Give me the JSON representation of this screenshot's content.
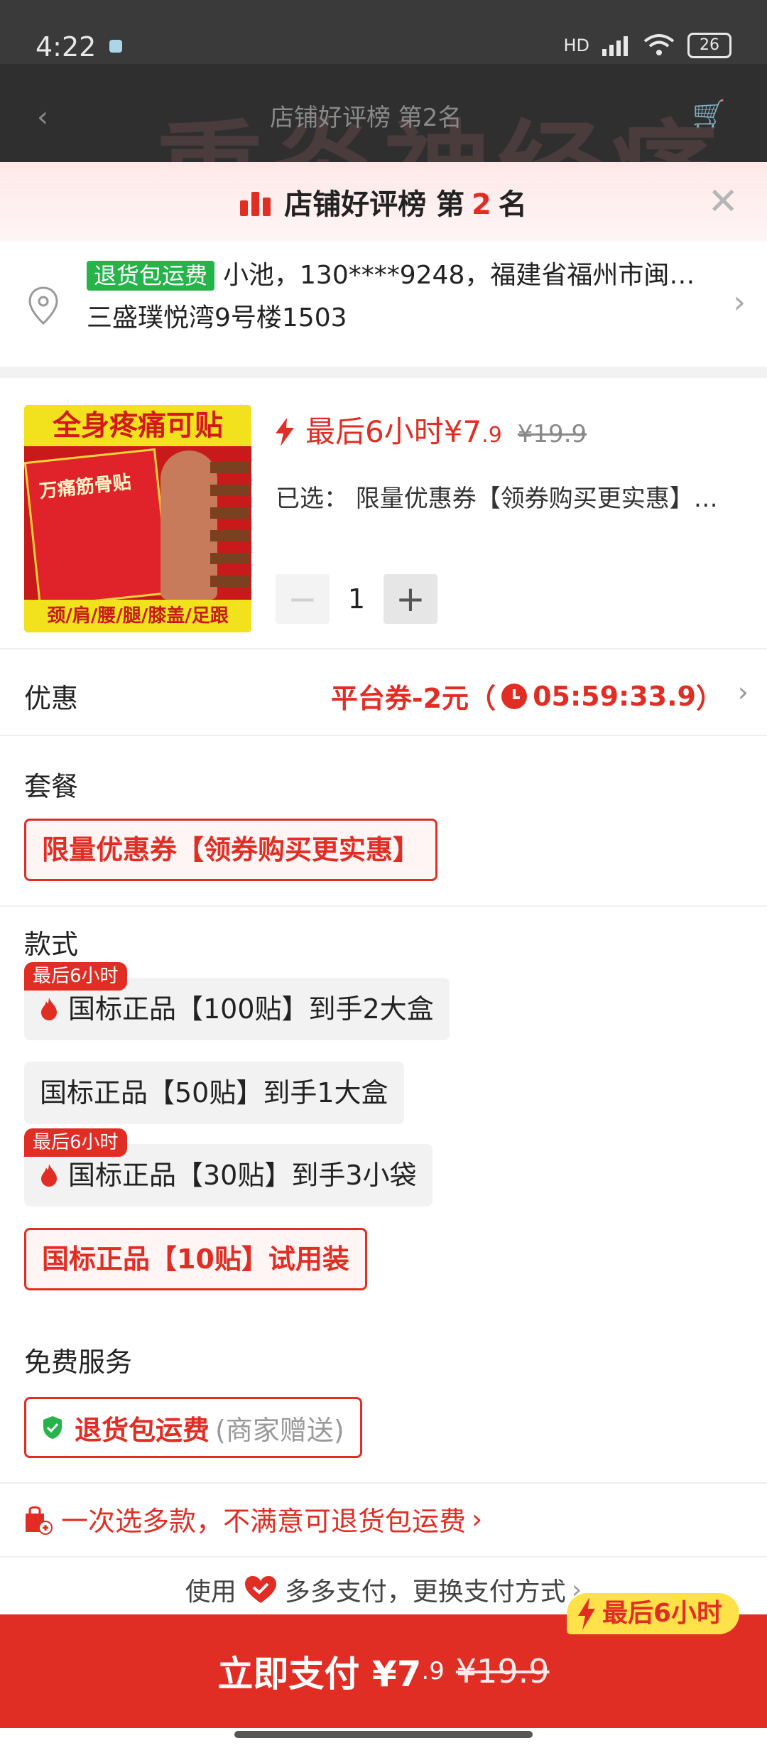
{
  "status_bar": {
    "time": "4:22",
    "battery": "26",
    "network": "HD"
  },
  "backdrop": {
    "title": "店铺好评榜 第2名",
    "ghost_text": "重炎神经痛"
  },
  "sheet": {
    "header": {
      "title_prefix": "店铺好评榜 第",
      "rank": "2",
      "title_suffix": "名"
    },
    "address": {
      "tag": "退货包运费",
      "line1": "小池，130****9248，福建省福州市闽…",
      "line2": "三盛璞悦湾9号楼1503"
    },
    "product": {
      "image_top": "全身疼痛可贴",
      "image_box": "万痛筋骨贴",
      "image_bottom": "颈/肩/腰/腿/膝盖/足跟",
      "price_label": "最后6小时¥7",
      "price_decimal": ".9",
      "old_price": "¥19.9",
      "selected": "已选： 限量优惠券【领券购买更实惠】…",
      "quantity": "1"
    },
    "discount": {
      "label": "优惠",
      "value_prefix": "平台券-2元（",
      "countdown": "05:59:33.9",
      "value_suffix": "）"
    },
    "package": {
      "title": "套餐",
      "option": "限量优惠券【领券购买更实惠】"
    },
    "style": {
      "title": "款式",
      "badge": "最后6小时",
      "options": [
        {
          "label": "国标正品【100贴】到手2大盒",
          "hot": true
        },
        {
          "label": "国标正品【50贴】到手1大盒",
          "hot": false
        },
        {
          "label": "国标正品【30贴】到手3小袋",
          "hot": true
        },
        {
          "label": "国标正品【10贴】试用装",
          "selected": true
        }
      ]
    },
    "service": {
      "title": "免费服务",
      "main": "退货包运费",
      "sub": "(商家赠送)"
    },
    "promo": "一次选多款，不满意可退货包运费",
    "pay_method": {
      "prefix": "使用",
      "name": "多多支付，更换支付方式"
    },
    "buy": {
      "label": "立即支付 ¥7",
      "decimal": ".9",
      "old_price": "¥19.9",
      "badge": "最后6小时"
    }
  },
  "colors": {
    "accent": "#e02e24",
    "green_tag": "#25b34a",
    "badge_yellow": "#ffe14a"
  }
}
